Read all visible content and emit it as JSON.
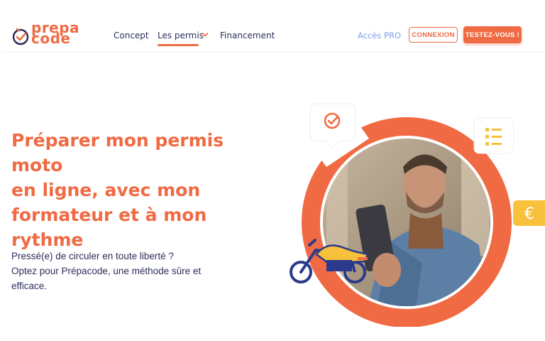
{
  "brand": {
    "line1": "prepa",
    "line2": "code"
  },
  "nav": {
    "links": [
      {
        "label": "Concept"
      },
      {
        "label": "Les permis"
      },
      {
        "label": "Financement"
      }
    ],
    "pro_label": "Accès PRO",
    "login_label": "CONNEXION",
    "cta_label": "TESTEZ-VOUS !"
  },
  "hero": {
    "title_lines": [
      "Préparer mon permis moto",
      "en ligne, avec mon",
      "formateur et à mon",
      "rythme"
    ],
    "subtitle_lines": [
      "Pressé(e) de circuler en toute liberté ?",
      "Optez pour Prépacode, une méthode sûre et",
      "efficace."
    ]
  },
  "colors": {
    "accent": "#f06a43",
    "navy": "#2b2f5a",
    "pro_blue": "#7ea2e6",
    "yellow": "#f7c13b"
  },
  "icons": [
    "check-badge-icon",
    "checklist-icon",
    "euro-icon",
    "motorcycle-icon",
    "chevron-down-icon"
  ]
}
